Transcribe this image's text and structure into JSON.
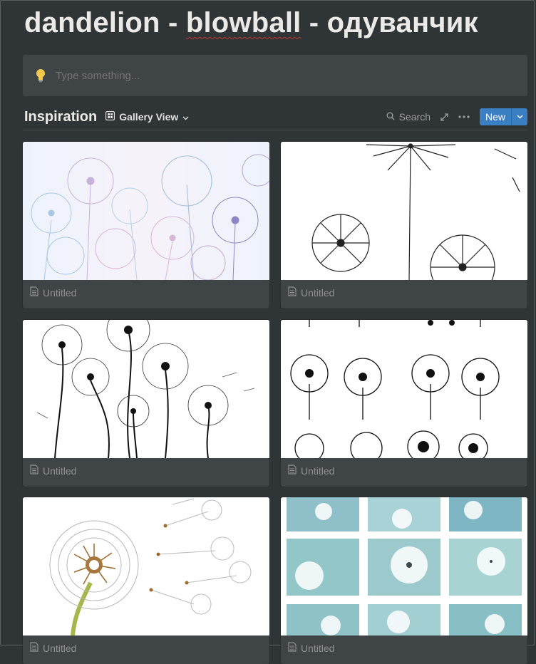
{
  "page": {
    "title_parts": [
      "dandelion - ",
      "blowball",
      " - одуванчик"
    ]
  },
  "callout": {
    "icon": "lightbulb-icon",
    "placeholder": "Type something..."
  },
  "database": {
    "title": "Inspiration",
    "view_label": "Gallery View",
    "search_label": "Search",
    "new_label": "New"
  },
  "cards": [
    {
      "title": "Untitled",
      "image": "pastel dandelions"
    },
    {
      "title": "Untitled",
      "image": "line-art dandelions"
    },
    {
      "title": "Untitled",
      "image": "black dandelions with stems"
    },
    {
      "title": "Untitled",
      "image": "dandelion pattern"
    },
    {
      "title": "Untitled",
      "image": "white dandelion blowing seeds"
    },
    {
      "title": "Untitled",
      "image": "teal dandelion photo grid"
    }
  ],
  "colors": {
    "background": "#2f3437",
    "callout_bg": "#3f4447",
    "accent": "#3a7fc1",
    "muted_text": "#8f9294"
  }
}
